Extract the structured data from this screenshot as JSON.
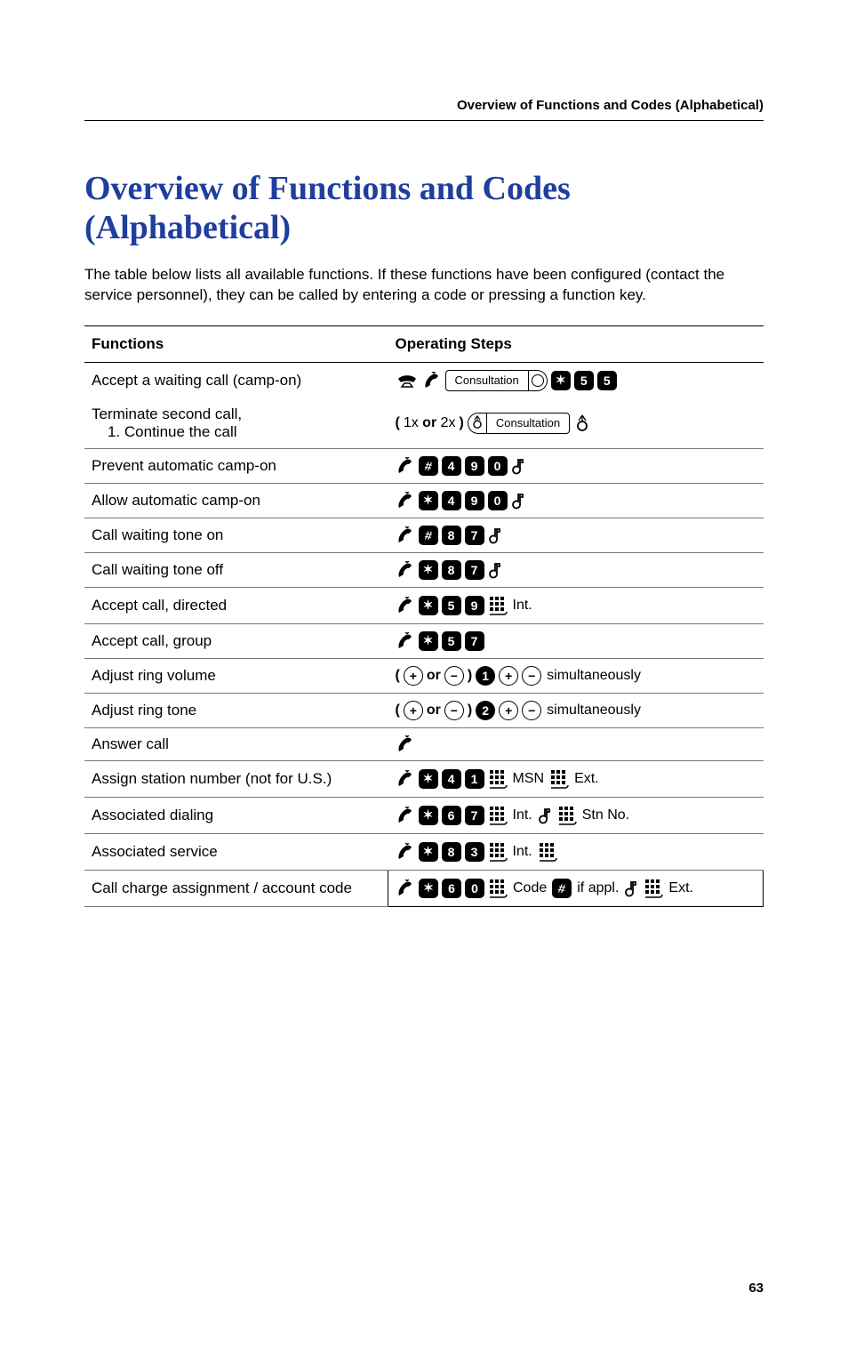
{
  "running_header": "Overview of Functions and Codes (Alphabetical)",
  "title": "Overview of Functions and Codes (Alphabetical)",
  "intro": "The table below lists all available functions. If these functions have been configured (contact the service personnel), they can be called by entering a code or pressing a function key.",
  "headers": {
    "functions": "Functions",
    "steps": "Operating Steps"
  },
  "labels": {
    "consultation": "Consultation",
    "one_or_two": "(1x or 2x)",
    "or": "or",
    "simultaneously": "simultaneously",
    "int": "Int.",
    "msn": "MSN",
    "ext": "Ext.",
    "stn_no": "Stn No.",
    "code": "Code",
    "if_appl": "if appl."
  },
  "rows": {
    "r0": "Accept a waiting call (camp-on)",
    "r1a": "Terminate second call,",
    "r1b": "1. Continue the call",
    "r2": "Prevent automatic camp-on",
    "r3": "Allow automatic camp-on",
    "r4": "Call waiting tone on",
    "r5": "Call waiting tone off",
    "r6": "Accept call, directed",
    "r7": "Accept call, group",
    "r8": "Adjust ring volume",
    "r9": "Adjust ring tone",
    "r10": "Answer call",
    "r11": "Assign station number (not for U.S.)",
    "r12": "Associated dialing",
    "r13": "Associated service",
    "r14": "Call charge assignment / account code"
  },
  "chart_data": {
    "type": "table",
    "title": "Overview of Functions and Codes (Alphabetical)",
    "columns": [
      "Functions",
      "Operating Steps"
    ],
    "rows": [
      {
        "function": "Accept a waiting call (camp-on)",
        "steps": "Handset on-hook, Lift handset, [Consultation] button, *55"
      },
      {
        "function": "Terminate second call, 1. Continue the call",
        "steps": "(1x or 2x) [Consultation] button (with lamp)"
      },
      {
        "function": "Prevent automatic camp-on",
        "steps": "Lift handset, #490, confirmation tone"
      },
      {
        "function": "Allow automatic camp-on",
        "steps": "Lift handset, *490, confirmation tone"
      },
      {
        "function": "Call waiting tone on",
        "steps": "Lift handset, #87, confirmation tone"
      },
      {
        "function": "Call waiting tone off",
        "steps": "Lift handset, *87, confirmation tone"
      },
      {
        "function": "Accept call, directed",
        "steps": "Lift handset, *59, dial Int."
      },
      {
        "function": "Accept call, group",
        "steps": "Lift handset, *57"
      },
      {
        "function": "Adjust ring volume",
        "steps": "(+ or -) 1, + - simultaneously"
      },
      {
        "function": "Adjust ring tone",
        "steps": "(+ or -) 2, + - simultaneously"
      },
      {
        "function": "Answer call",
        "steps": "Lift handset"
      },
      {
        "function": "Assign station number (not for U.S.)",
        "steps": "Lift handset, *41, dial MSN, dial Ext."
      },
      {
        "function": "Associated dialing",
        "steps": "Lift handset, *67, dial Int., confirmation tone, dial Stn No."
      },
      {
        "function": "Associated service",
        "steps": "Lift handset, *83, dial Int., dial"
      },
      {
        "function": "Call charge assignment / account code",
        "steps": "Lift handset, *60, dial Code, # if appl., confirmation tone, dial Ext."
      }
    ]
  },
  "page_number": "63"
}
